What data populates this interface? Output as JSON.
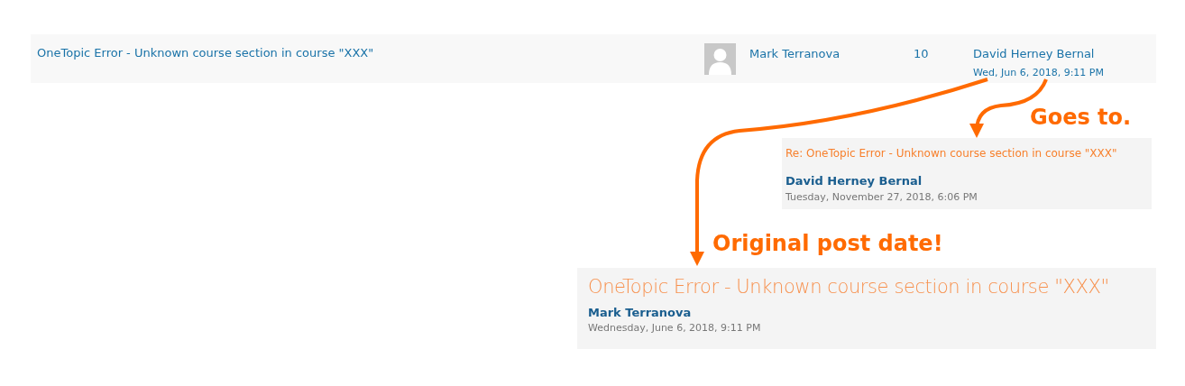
{
  "discussion_row": {
    "title": "OneTopic Error - Unknown course section in course \"XXX\"",
    "started_by": "Mark Terranova",
    "replies": "10",
    "last_post_author": "David Herney Bernal",
    "last_post_date": "Wed, Jun 6, 2018, 9:11 PM"
  },
  "reply_post": {
    "subject": "Re: OneTopic Error - Unknown course section in course \"XXX\"",
    "author": "David Herney Bernal",
    "date": "Tuesday, November 27, 2018, 6:06 PM"
  },
  "original_post": {
    "subject": "OneTopic Error - Unknown course section in course \"XXX\"",
    "author": "Mark Terranova",
    "date": "Wednesday, June 6, 2018, 9:11 PM"
  },
  "annotations": [
    "Goes to.",
    "Original post date!"
  ]
}
